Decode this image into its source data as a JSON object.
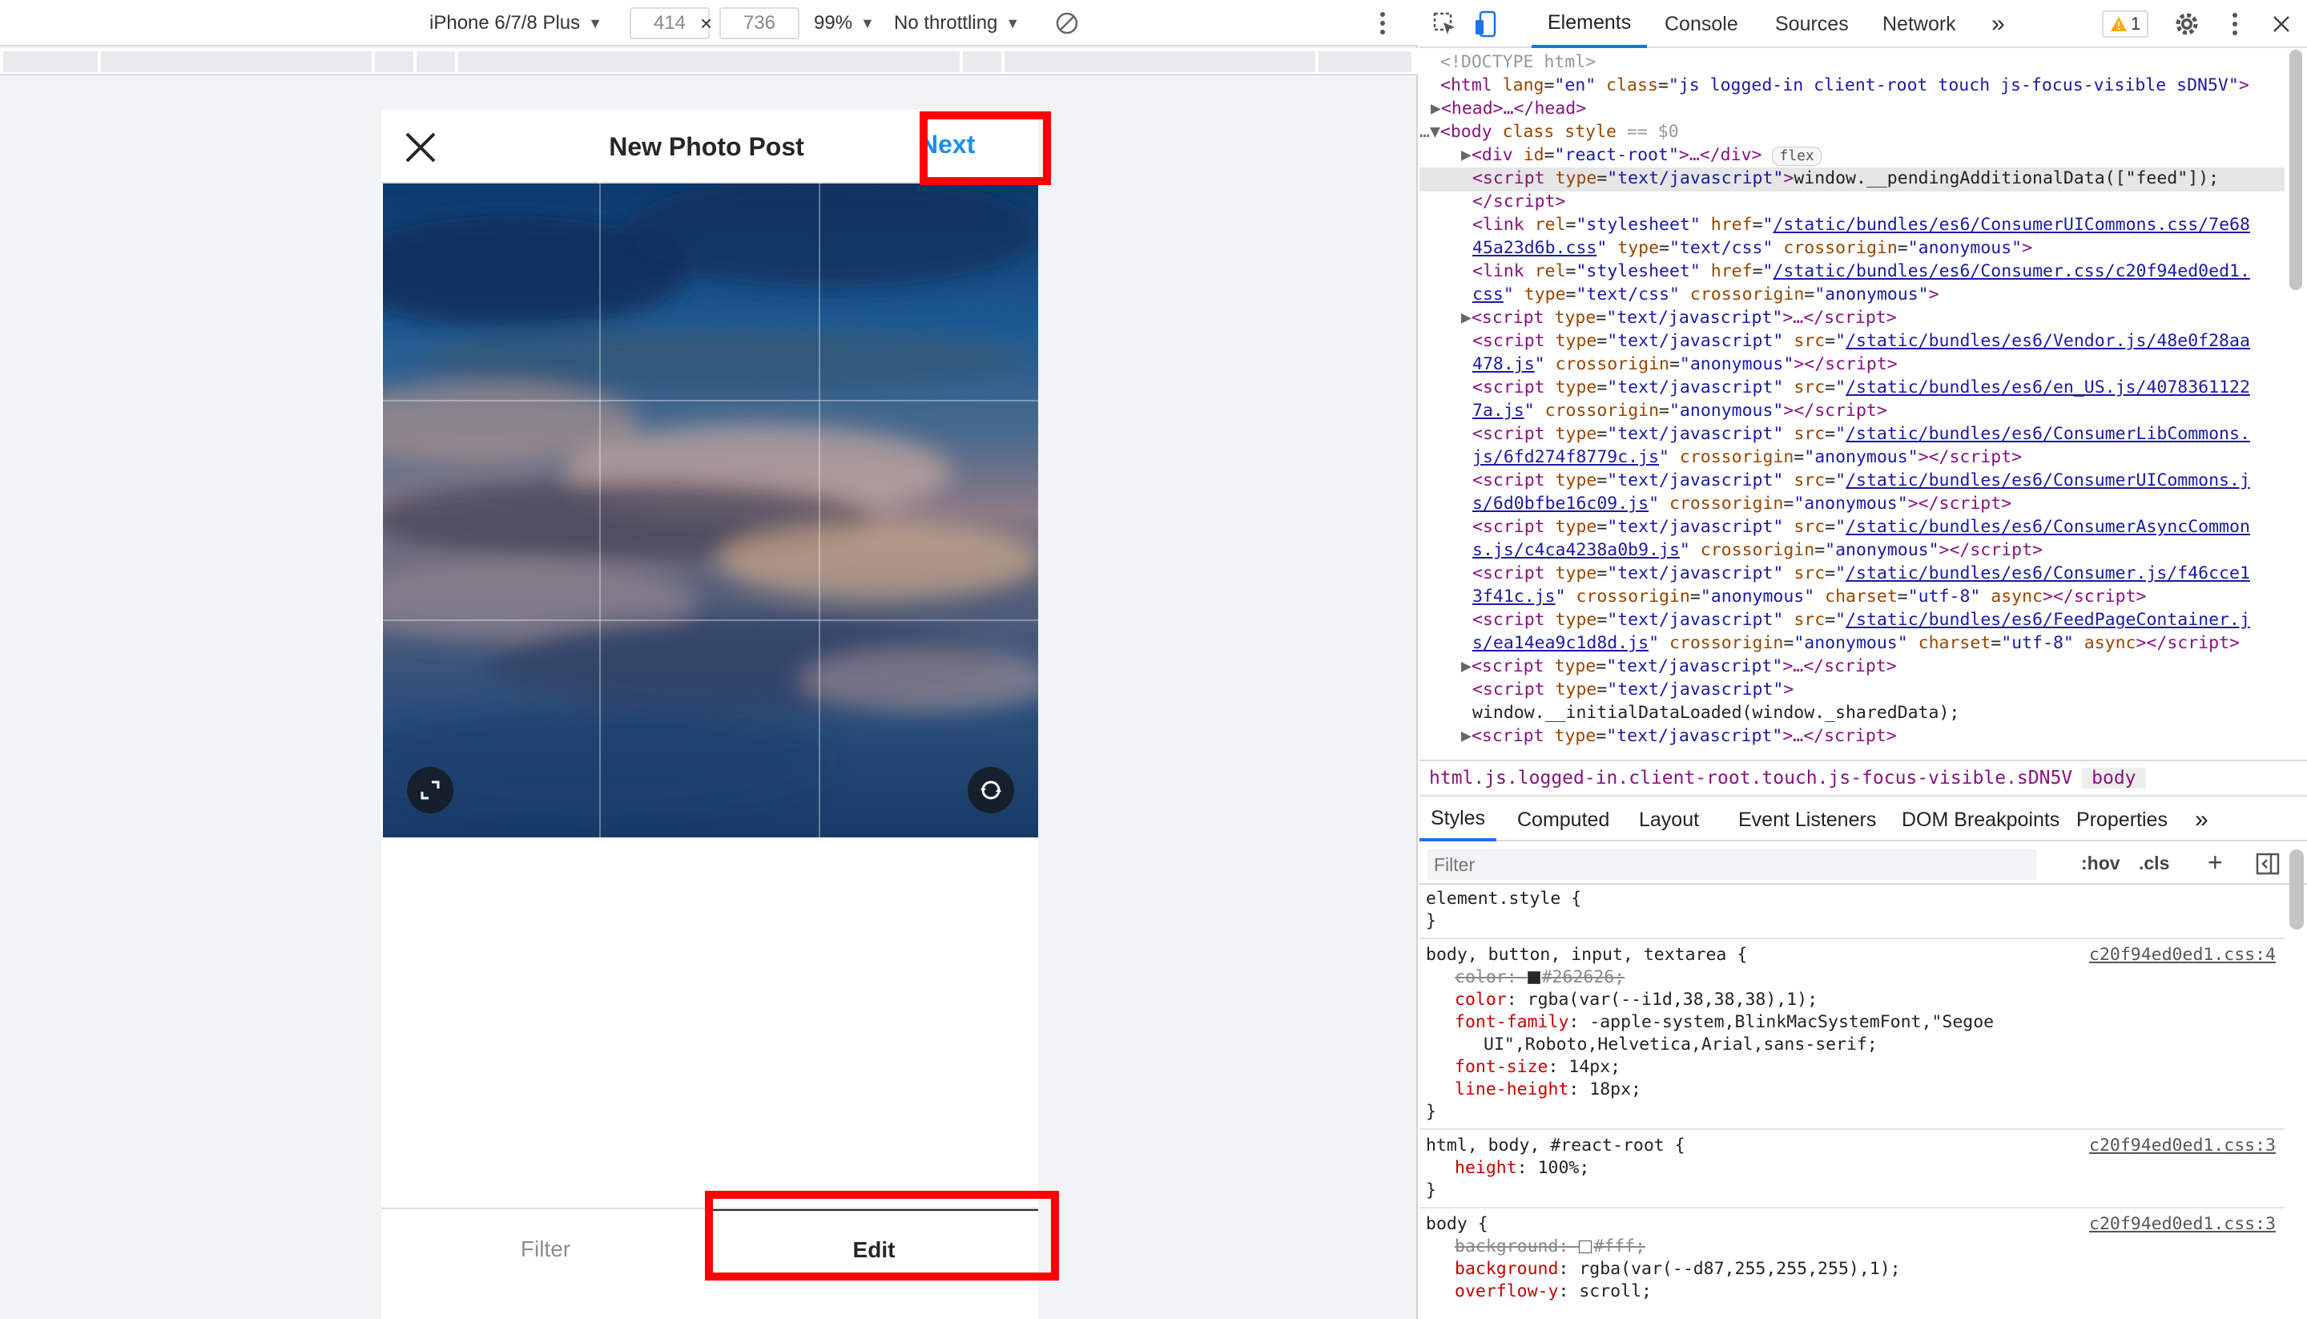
{
  "device_toolbar": {
    "device": "iPhone 6/7/8 Plus",
    "width": "414",
    "times": "×",
    "height": "736",
    "zoom": "99%",
    "throttling": "No throttling",
    "icons": [
      "rotate-icon",
      "more-vert-icon"
    ]
  },
  "app": {
    "title": "New Photo Post",
    "next_label": "Next",
    "tabs": {
      "filter": "Filter",
      "edit": "Edit"
    },
    "icons": [
      "close-icon",
      "expand-icon",
      "rotate-photo-icon"
    ]
  },
  "devtools": {
    "tabs": [
      "Elements",
      "Console",
      "Sources",
      "Network"
    ],
    "active_tab": "Elements",
    "more": "»",
    "warnings": "1",
    "icons": [
      "inspect-icon",
      "device-toggle-icon",
      "warning-icon",
      "settings-icon",
      "more-vert-icon",
      "close-icon"
    ],
    "dom": {
      "doctype": "<!DOCTYPE html>",
      "html_open": [
        "html",
        "lang",
        "en",
        "class",
        "js logged-in client-root touch js-focus-visible sDN5V"
      ],
      "head": "<head>…</head>",
      "body_line": [
        "body",
        "class",
        "style",
        "== $0"
      ],
      "react_root": [
        "div",
        "id",
        "react-root",
        "flex"
      ],
      "script_pending": "window.__pendingAdditionalData([\"feed\"]);",
      "links": [
        {
          "href": "/static/bundles/es6/ConsumerUICommons.css/7e68",
          "href2": "45a23d6b.css"
        },
        {
          "href": "/static/bundles/es6/Consumer.css/c20f94ed0ed1.",
          "href2": "css"
        }
      ],
      "scripts": [
        {
          "src": "/static/bundles/es6/Vendor.js/48e0f28aa",
          "src2": "478.js"
        },
        {
          "src": "/static/bundles/es6/en_US.js/4078361122",
          "src2": "7a.js"
        },
        {
          "src": "/static/bundles/es6/ConsumerLibCommons.",
          "src2": "js/6fd274f8779c.js"
        },
        {
          "src": "/static/bundles/es6/ConsumerUICommons.j",
          "src2": "s/6d0bfbe16c09.js"
        },
        {
          "src": "/static/bundles/es6/ConsumerAsyncCommon",
          "src2": "s.js/c4ca4238a0b9.js"
        },
        {
          "src": "/static/bundles/es6/Consumer.js/f46cce1",
          "src2": "3f41c.js"
        },
        {
          "src": "/static/bundles/es6/FeedPageContainer.j",
          "src2": "s/ea14ea9c1d8d.js"
        }
      ],
      "initial_data": "window.__initialDataLoaded(window._sharedData);"
    },
    "breadcrumbs": [
      "html.js.logged-in.client-root.touch.js-focus-visible.sDN5V",
      "body"
    ],
    "styles_tabs": [
      "Styles",
      "Computed",
      "Layout",
      "Event Listeners",
      "DOM Breakpoints",
      "Properties",
      "»"
    ],
    "filter_placeholder": "Filter",
    "hov": ":hov",
    "cls": ".cls",
    "rules": {
      "element_style": "element.style {",
      "r1_selector": "body, button, input, textarea {",
      "r1_source": "c20f94ed0ed1.css:4",
      "r1_color_struck": "#262626;",
      "r1_color": "rgba(var(--i1d,38,38,38),1);",
      "r1_font_family": "-apple-system,BlinkMacSystemFont,\"Segoe",
      "r1_font_family2": "UI\",Roboto,Helvetica,Arial,sans-serif;",
      "r1_font_size": "14px;",
      "r1_line_height": "18px;",
      "r2_selector": "html, body, #react-root {",
      "r2_source": "c20f94ed0ed1.css:3",
      "r2_height": "100%;",
      "r3_selector": "body {",
      "r3_source": "c20f94ed0ed1.css:3",
      "r3_bg_struck": "#fff;",
      "r3_bg": "rgba(var(--d87,255,255,255),1);",
      "r3_overflow": "scroll;"
    }
  },
  "colors": {
    "accent": "#1c8fef",
    "highlight": "#ff0000",
    "devtools_active": "#1a73e8"
  }
}
